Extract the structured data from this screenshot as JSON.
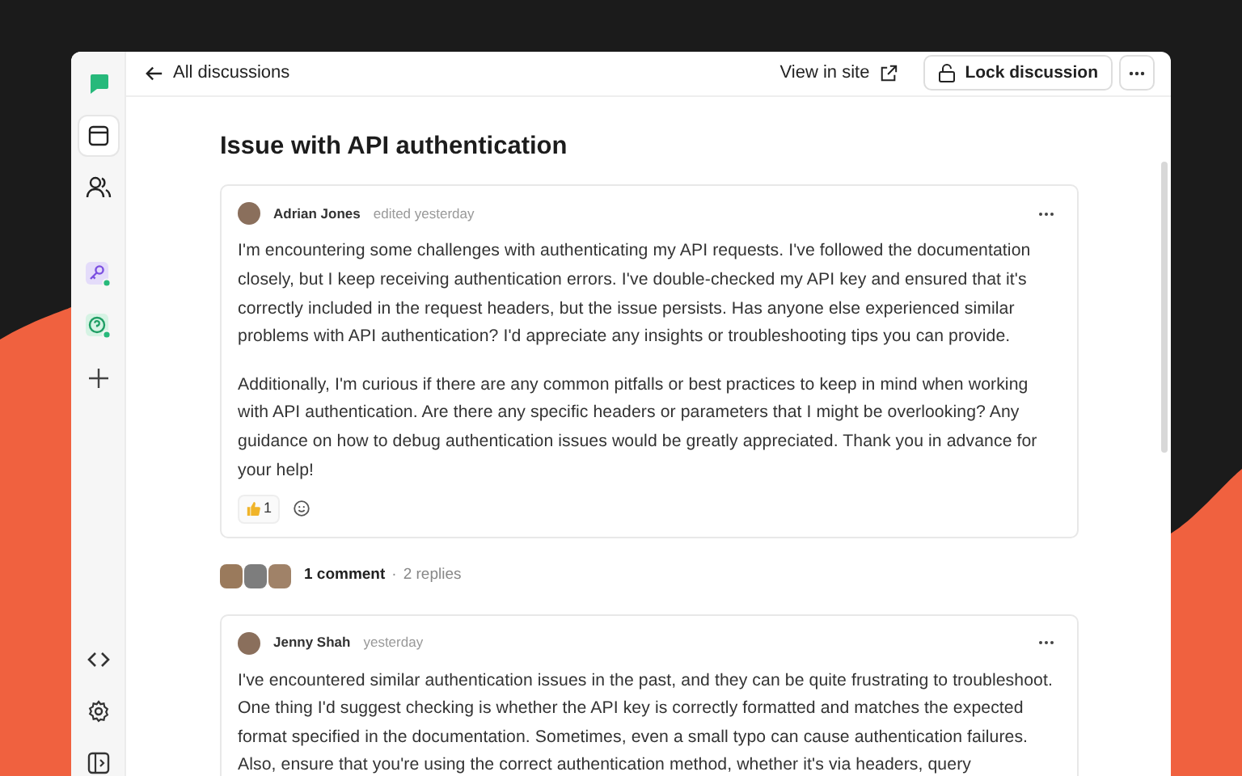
{
  "sidebar": {
    "top_items": [
      {
        "kind": "logo",
        "selected": false
      },
      {
        "kind": "layout",
        "selected": true
      },
      {
        "kind": "users",
        "selected": false
      },
      {
        "kind": "key-app",
        "selected": false
      },
      {
        "kind": "help-app",
        "selected": false
      },
      {
        "kind": "add",
        "selected": false
      }
    ],
    "bottom_items": [
      {
        "kind": "code"
      },
      {
        "kind": "settings"
      },
      {
        "kind": "panel"
      }
    ]
  },
  "topbar": {
    "back_link": "All discussions",
    "view_link": "View in site",
    "lock_button": "Lock discussion"
  },
  "discussion": {
    "title": "Issue with API authentication",
    "post": {
      "author": "Adrian Jones",
      "meta": "edited yesterday",
      "paragraphs": [
        "I'm encountering some challenges with authenticating my API requests. I've followed the documentation closely, but I keep receiving authentication errors. I've double-checked my API key and ensured that it's correctly included in the request headers, but the issue persists. Has anyone else experienced similar problems with API authentication? I'd appreciate any insights or troubleshooting tips you can provide.",
        "Additionally, I'm curious if there are any common pitfalls or best practices to keep in mind when working with API authentication. Are there any specific headers or parameters that I might be overlooking? Any guidance on how to debug authentication issues would be greatly appreciated. Thank you in advance for your help!"
      ],
      "reactions": [
        {
          "count": "1"
        }
      ]
    },
    "summary": {
      "avatars": [
        {
          "kind": "photo"
        },
        {
          "kind": "photo"
        },
        {
          "kind": "photo"
        }
      ],
      "comments": "1 comment",
      "separator": "·",
      "replies": "2 replies"
    },
    "reply": {
      "author": "Jenny Shah",
      "meta": "yesterday",
      "paragraphs": [
        "I've encountered similar authentication issues in the past, and they can be quite frustrating to troubleshoot. One thing I'd suggest checking is whether the API key is correctly formatted and matches the expected format specified in the documentation. Sometimes, even a small typo can cause authentication failures. Also, ensure that you're using the correct authentication method, whether it's via headers, query"
      ]
    }
  }
}
